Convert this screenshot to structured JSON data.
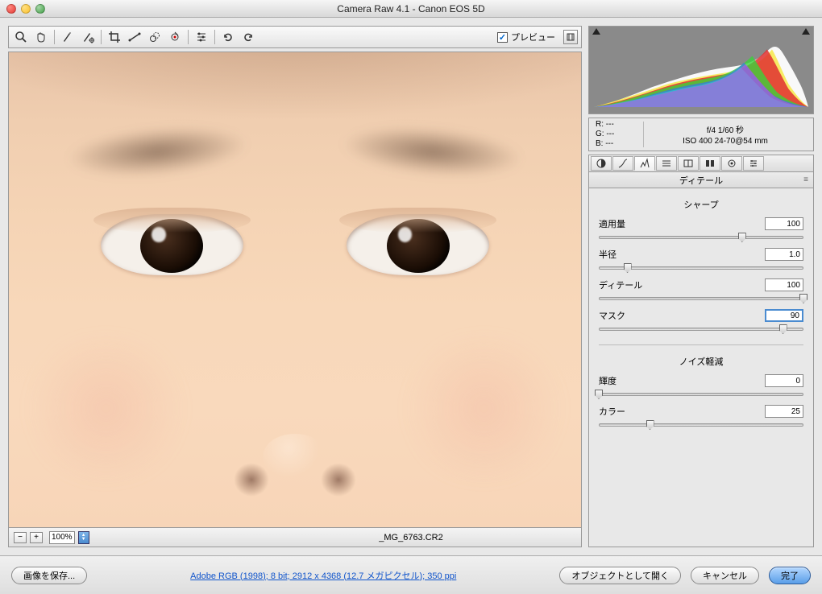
{
  "window": {
    "title": "Camera Raw 4.1  -  Canon EOS 5D"
  },
  "toolbar": {
    "preview_label": "プレビュー"
  },
  "zoom": {
    "level": "100%",
    "filename": "_MG_6763.CR2"
  },
  "rgb": {
    "r": "R:   ---",
    "g": "G:   ---",
    "b": "B:   ---"
  },
  "exif": {
    "line1": "f/4   1/60 秒",
    "line2": "ISO 400   24-70@54 mm"
  },
  "panel": {
    "title": "ディテール"
  },
  "sharpen": {
    "title": "シャープ",
    "amount": {
      "label": "適用量",
      "value": "100",
      "pos": 70
    },
    "radius": {
      "label": "半径",
      "value": "1.0",
      "pos": 14
    },
    "detail": {
      "label": "ディテール",
      "value": "100",
      "pos": 100
    },
    "mask": {
      "label": "マスク",
      "value": "90",
      "pos": 90
    }
  },
  "noise": {
    "title": "ノイズ軽減",
    "luminance": {
      "label": "輝度",
      "value": "0",
      "pos": 0
    },
    "color": {
      "label": "カラー",
      "value": "25",
      "pos": 25
    }
  },
  "footer": {
    "save": "画像を保存...",
    "link": "Adobe RGB (1998); 8 bit; 2912 x 4368 (12.7 メガピクセル); 350 ppi",
    "open": "オブジェクトとして開く",
    "cancel": "キャンセル",
    "done": "完了"
  }
}
